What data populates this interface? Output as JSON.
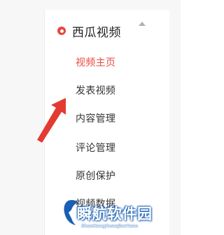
{
  "menu": {
    "title": "西瓜视频",
    "logo_icon": "xigua-logo-icon",
    "collapse_icon": "chevron-up-icon",
    "items": [
      {
        "label": "视频主页",
        "active": true
      },
      {
        "label": "发表视频",
        "active": false
      },
      {
        "label": "内容管理",
        "active": false
      },
      {
        "label": "评论管理",
        "active": false
      },
      {
        "label": "原创保护",
        "active": false
      },
      {
        "label": "视频数据",
        "active": false
      }
    ]
  },
  "annotation": {
    "icon": "red-arrow-icon",
    "color": "#e33b31"
  },
  "watermark": {
    "title": "瞬航软件园",
    "subtitle": "ShunHangRuanJianYuan"
  },
  "colors": {
    "accent": "#e84a3f",
    "text": "#333333"
  }
}
